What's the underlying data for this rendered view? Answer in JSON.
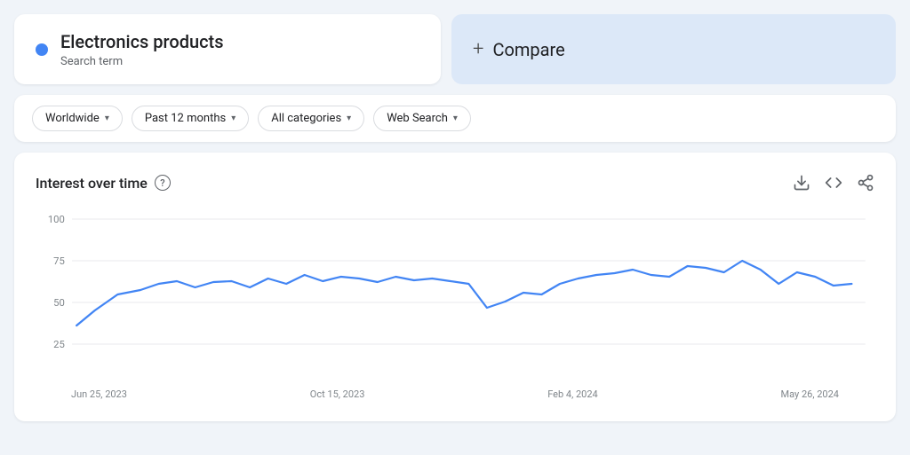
{
  "searchTerm": {
    "title": "Electronics products",
    "subtitle": "Search term",
    "dotColor": "#4285f4"
  },
  "compare": {
    "plusSymbol": "+",
    "label": "Compare"
  },
  "filters": [
    {
      "id": "location",
      "label": "Worldwide"
    },
    {
      "id": "timeRange",
      "label": "Past 12 months"
    },
    {
      "id": "category",
      "label": "All categories"
    },
    {
      "id": "searchType",
      "label": "Web Search"
    }
  ],
  "chart": {
    "title": "Interest over time",
    "helpText": "?",
    "downloadIcon": "⬇",
    "embedIcon": "<>",
    "shareIcon": "share",
    "yLabels": [
      "100",
      "75",
      "50",
      "25"
    ],
    "xLabels": [
      "Jun 25, 2023",
      "Oct 15, 2023",
      "Feb 4, 2024",
      "May 26, 2024"
    ],
    "lineColor": "#4285f4",
    "gridColor": "#e8eaed"
  }
}
